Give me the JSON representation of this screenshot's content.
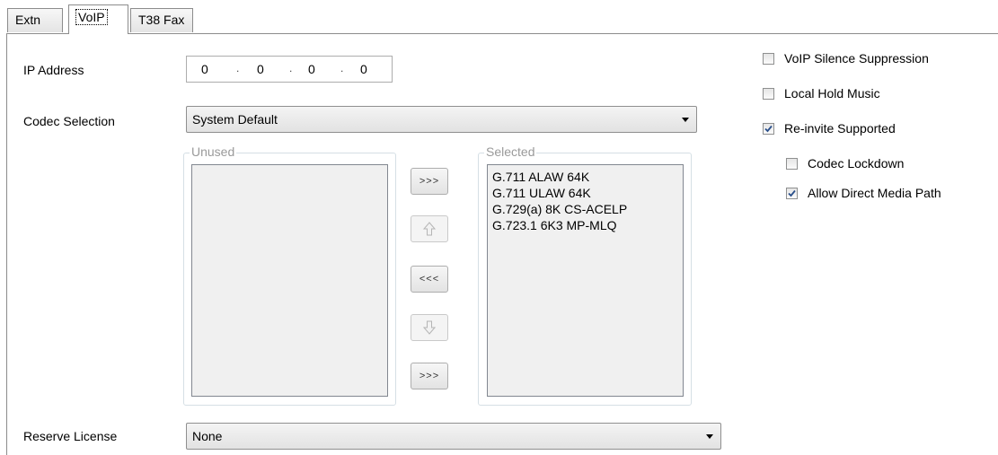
{
  "tabs": [
    {
      "label": "Extn",
      "active": false
    },
    {
      "label": "VoIP",
      "active": true
    },
    {
      "label": "T38 Fax",
      "active": false
    }
  ],
  "ip_address": {
    "label": "IP Address",
    "octets": [
      "0",
      "0",
      "0",
      "0"
    ]
  },
  "codec_selection": {
    "label": "Codec Selection",
    "value": "System Default"
  },
  "unused": {
    "title": "Unused",
    "items": []
  },
  "selected": {
    "title": "Selected",
    "items": [
      "G.711 ALAW 64K",
      "G.711 ULAW 64K",
      "G.729(a) 8K CS-ACELP",
      "G.723.1 6K3 MP-MLQ"
    ]
  },
  "buttons": {
    "add_label": ">>>",
    "remove_label": "<<<",
    "add_all_label": ">>>"
  },
  "reserve_license": {
    "label": "Reserve License",
    "value": "None"
  },
  "options": [
    {
      "label": "VoIP Silence Suppression",
      "checked": false,
      "indent": false
    },
    {
      "label": "Local Hold Music",
      "checked": false,
      "indent": false
    },
    {
      "label": "Re-invite Supported",
      "checked": true,
      "indent": false
    },
    {
      "label": "Codec Lockdown",
      "checked": false,
      "indent": true
    },
    {
      "label": "Allow Direct Media Path",
      "checked": true,
      "indent": true
    }
  ],
  "colors": {
    "check": "#2a4f8a",
    "group_border": "#d5dfe5",
    "listbox_bg": "#f0f0f0"
  }
}
